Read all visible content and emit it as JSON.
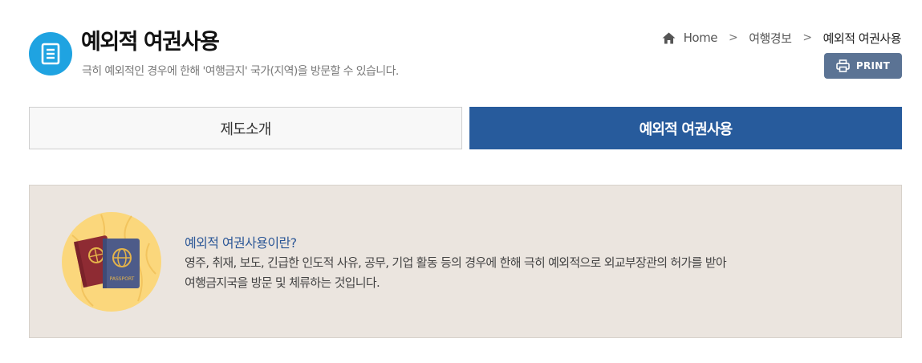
{
  "header": {
    "icon": "document-list-icon",
    "title": "예외적 여권사용",
    "subtitle": "극히 예외적인 경우에 한해 '여행금지' 국가(지역)을 방문할 수 있습니다."
  },
  "breadcrumb": {
    "home_icon": "home-icon",
    "items": [
      "Home",
      "여행경보",
      "예외적 여권사용"
    ],
    "separator": ">"
  },
  "print_button": {
    "label": "PRINT",
    "icon": "printer-icon"
  },
  "tabs": [
    {
      "label": "제도소개",
      "active": false
    },
    {
      "label": "예외적 여권사용",
      "active": true
    }
  ],
  "info": {
    "illustration": "passport-illustration",
    "passport_text": "PASSPORT",
    "title": "예외적 여권사용이란?",
    "desc_lines": [
      "영주, 취재, 보도, 긴급한 인도적 사유, 공무, 기업 활동 등의 경우에 한해 극히 예외적으로 외교부장관의 허가를 받아",
      "여행금지국을 방문 및 체류하는 것입니다."
    ]
  },
  "colors": {
    "accent_blue": "#275b9c",
    "icon_blue": "#1fa3e1",
    "print_button": "#5b7394",
    "info_background": "#ebe5df",
    "info_title": "#2d5897"
  }
}
